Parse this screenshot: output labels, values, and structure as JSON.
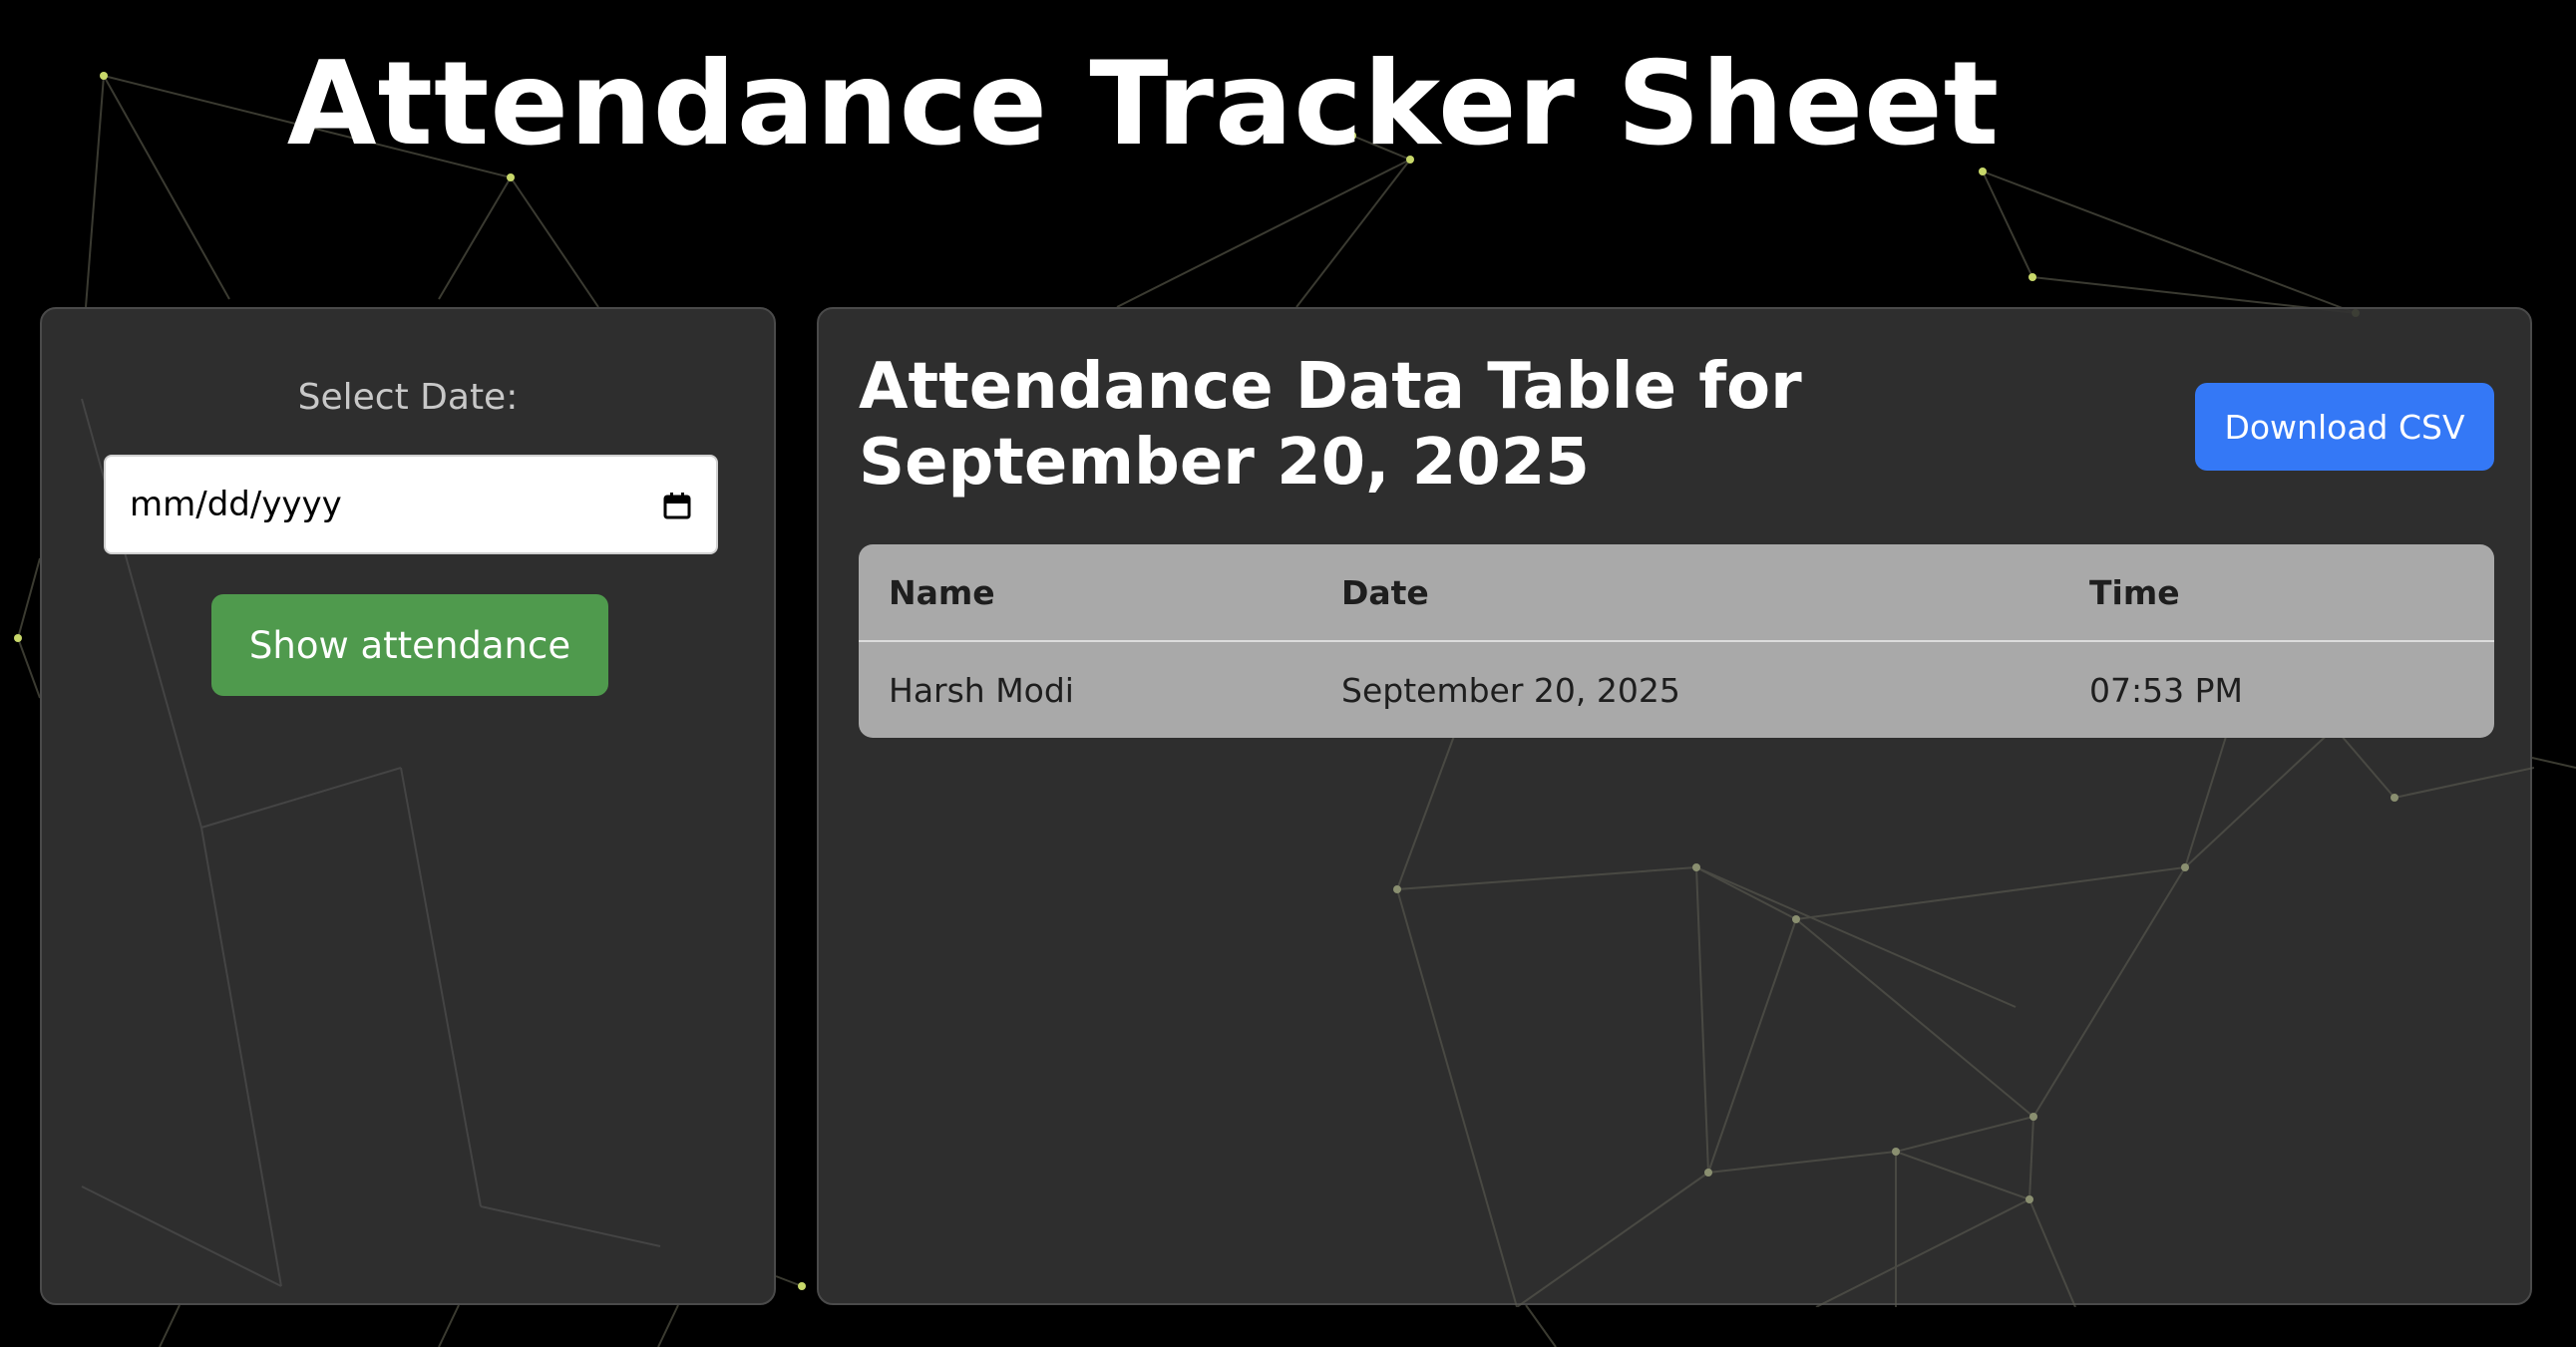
{
  "page": {
    "title": "Attendance Tracker Sheet"
  },
  "filter": {
    "label": "Select Date:",
    "date_placeholder": "mm/dd/yyyy",
    "calendar_icon": "calendar-icon",
    "show_button": "Show attendance"
  },
  "table_panel": {
    "heading_line1": "Attendance Data Table for",
    "heading_line2": "September 20, 2025",
    "download_button": "Download CSV",
    "columns": [
      "Name",
      "Date",
      "Time"
    ],
    "rows": [
      [
        "Harsh Modi",
        "September 20, 2025",
        "07:53 PM"
      ]
    ]
  },
  "colors": {
    "background": "#000000",
    "panel": "#323232",
    "show_button": "#4f9a4d",
    "download_button": "#3478f6",
    "table": "#a9a9a9",
    "network_node": "#c8d86a"
  }
}
